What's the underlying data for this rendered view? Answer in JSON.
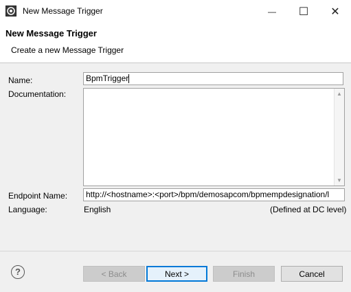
{
  "window": {
    "title": "New Message Trigger",
    "minimize_glyph": "—",
    "maximize_glyph": "☐",
    "close_glyph": "✕"
  },
  "header": {
    "title": "New Message Trigger",
    "subtitle": "Create a new Message Trigger"
  },
  "form": {
    "name_label": "Name:",
    "name_value": "BpmTrigger",
    "documentation_label": "Documentation:",
    "documentation_value": "",
    "endpoint_label": "Endpoint Name:",
    "endpoint_value": "http://<hostname>:<port>/bpm/demosapcom/bpmempdesignation/l",
    "language_label": "Language:",
    "language_value": "English",
    "language_note": "(Defined at DC level)"
  },
  "footer": {
    "help_glyph": "?",
    "back_label": "< Back",
    "next_label": "Next >",
    "finish_label": "Finish",
    "cancel_label": "Cancel"
  }
}
